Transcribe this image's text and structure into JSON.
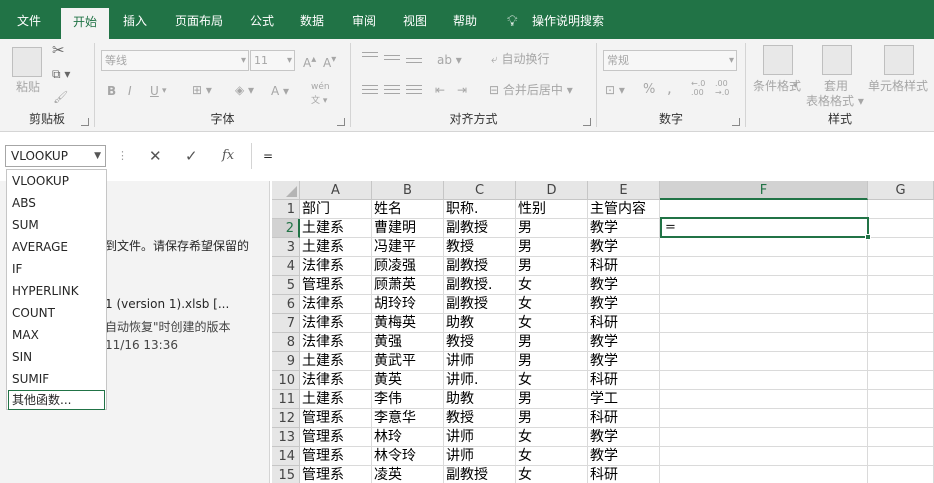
{
  "tabs": [
    {
      "label": "文件"
    },
    {
      "label": "开始"
    },
    {
      "label": "插入"
    },
    {
      "label": "页面布局"
    },
    {
      "label": "公式"
    },
    {
      "label": "数据"
    },
    {
      "label": "审阅"
    },
    {
      "label": "视图"
    },
    {
      "label": "帮助"
    }
  ],
  "tell_me": "操作说明搜索",
  "ribbon": {
    "clipboard": {
      "label": "剪贴板",
      "paste": "粘贴"
    },
    "font": {
      "label": "字体",
      "font_name": "等线",
      "font_size": "11",
      "bold": "B",
      "italic": "I",
      "underline": "U",
      "font_color": "A",
      "phonetic": "wén"
    },
    "alignment": {
      "label": "对齐方式",
      "wrap": "自动换行",
      "merge": "合并后居中"
    },
    "number": {
      "label": "数字",
      "format": "常规",
      "percent": "%",
      "comma": ",",
      "inc_decimal": "←.0 .00",
      "dec_decimal": ".00 →.0"
    },
    "styles": {
      "label": "样式",
      "conditional": "条件格式",
      "table_line1": "套用",
      "table_line2": "表格格式",
      "cell_styles": "单元格样式"
    }
  },
  "formula_bar": {
    "name_box": "VLOOKUP",
    "cancel": "✕",
    "enter": "✓",
    "fx": "fx",
    "content": "="
  },
  "function_list": [
    "VLOOKUP",
    "ABS",
    "SUM",
    "AVERAGE",
    "IF",
    "HYPERLINK",
    "COUNT",
    "MAX",
    "SIN",
    "SUMIF",
    "其他函数..."
  ],
  "recovery_pane": {
    "line1": "到文件。请保存希望保留的",
    "line2": "1 (version 1).xlsb  [...",
    "line3": "自动恢复\"时创建的版本",
    "line4": "11/16 13:36"
  },
  "sheet": {
    "columns": [
      "A",
      "B",
      "C",
      "D",
      "E",
      "F",
      "G"
    ],
    "rows": [
      {
        "n": "1",
        "c": [
          "部门",
          "姓名",
          "职称.",
          "性别",
          "主管内容"
        ]
      },
      {
        "n": "2",
        "c": [
          "土建系",
          "曹建明",
          "副教授",
          "男",
          "教学"
        ]
      },
      {
        "n": "3",
        "c": [
          "土建系",
          "冯建平",
          "教授",
          "男",
          "教学"
        ]
      },
      {
        "n": "4",
        "c": [
          "法律系",
          "顾凌强",
          "副教授",
          "男",
          "科研"
        ]
      },
      {
        "n": "5",
        "c": [
          "管理系",
          "顾萧英",
          "副教授.",
          "女",
          "教学"
        ]
      },
      {
        "n": "6",
        "c": [
          "法律系",
          "胡玲玲",
          "副教授",
          "女",
          "教学"
        ]
      },
      {
        "n": "7",
        "c": [
          "法律系",
          "黄梅英",
          "助教",
          "女",
          "科研"
        ]
      },
      {
        "n": "8",
        "c": [
          "法律系",
          "黄强",
          "教授",
          "男",
          "教学"
        ]
      },
      {
        "n": "9",
        "c": [
          "土建系",
          "黄武平",
          "讲师",
          "男",
          "教学"
        ]
      },
      {
        "n": "10",
        "c": [
          "法律系",
          "黄英",
          "讲师.",
          "女",
          "科研"
        ]
      },
      {
        "n": "11",
        "c": [
          "土建系",
          "李伟",
          "助教",
          "男",
          "学工"
        ]
      },
      {
        "n": "12",
        "c": [
          "管理系",
          "李意华",
          "教授",
          "男",
          "科研"
        ]
      },
      {
        "n": "13",
        "c": [
          "管理系",
          "林玲",
          "讲师",
          "女",
          "教学"
        ]
      },
      {
        "n": "14",
        "c": [
          "管理系",
          "林令玲",
          "讲师",
          "女",
          "教学"
        ]
      },
      {
        "n": "15",
        "c": [
          "管理系",
          "凌英",
          "副教授",
          "女",
          "科研"
        ]
      }
    ],
    "active_cell_value": "="
  },
  "colors": {
    "accent": "#217346",
    "ribbon_bg": "#f3f3f3",
    "header_bg": "#e6e6e6"
  }
}
